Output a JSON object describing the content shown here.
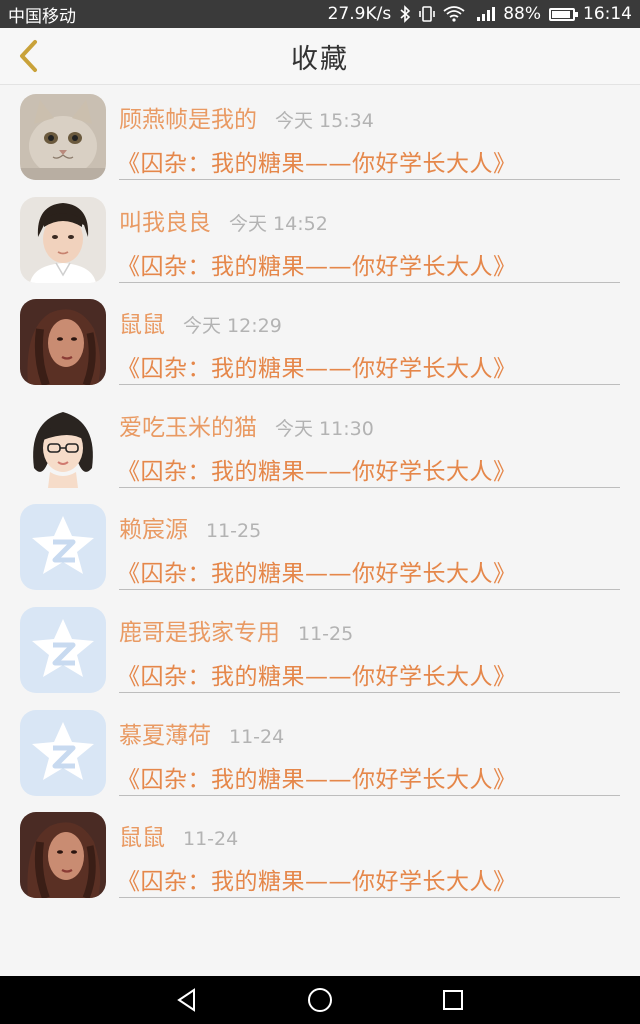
{
  "status_bar": {
    "carrier": "中国移动",
    "speed": "27.9K/s",
    "battery": "88%",
    "battery_level": 0.88,
    "time": "16:14"
  },
  "header": {
    "title": "收藏"
  },
  "items": [
    {
      "name": "顾燕帧是我的",
      "time": "今天 15:34",
      "book": "《囚杂：我的糖果——你好学长大人》",
      "avatar": "cat-avatar"
    },
    {
      "name": "叫我良良",
      "time": "今天 14:52",
      "book": "《囚杂：我的糖果——你好学长大人》",
      "avatar": "man-avatar"
    },
    {
      "name": "鼠鼠",
      "time": "今天 12:29",
      "book": "《囚杂：我的糖果——你好学长大人》",
      "avatar": "woman-avatar"
    },
    {
      "name": "爱吃玉米的猫",
      "time": "今天 11:30",
      "book": "《囚杂：我的糖果——你好学长大人》",
      "avatar": "cartoon-girl-avatar"
    },
    {
      "name": "赖宸源",
      "time": "11-25",
      "book": "《囚杂：我的糖果——你好学长大人》",
      "avatar": "qq-default-avatar"
    },
    {
      "name": "鹿哥是我家专用",
      "time": "11-25",
      "book": "《囚杂：我的糖果——你好学长大人》",
      "avatar": "qq-default-avatar"
    },
    {
      "name": "慕夏薄荷",
      "time": "11-24",
      "book": "《囚杂：我的糖果——你好学长大人》",
      "avatar": "qq-default-avatar"
    },
    {
      "name": "鼠鼠",
      "time": "11-24",
      "book": "《囚杂：我的糖果——你好学长大人》",
      "avatar": "woman-avatar"
    }
  ],
  "colors": {
    "accent": "#e5874a",
    "name": "#e99a63",
    "back_arrow": "#c9a23a"
  }
}
